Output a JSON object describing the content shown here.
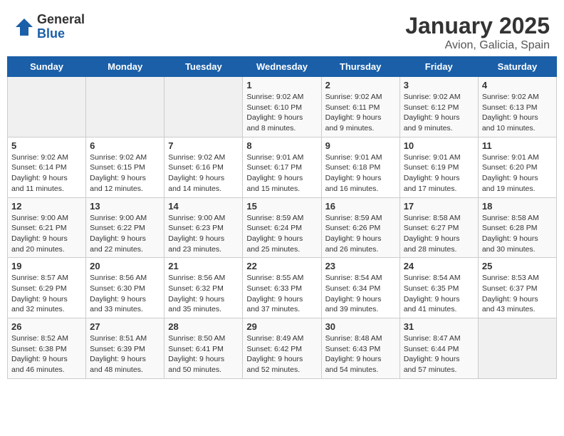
{
  "header": {
    "logo_general": "General",
    "logo_blue": "Blue",
    "title": "January 2025",
    "subtitle": "Avion, Galicia, Spain"
  },
  "weekdays": [
    "Sunday",
    "Monday",
    "Tuesday",
    "Wednesday",
    "Thursday",
    "Friday",
    "Saturday"
  ],
  "weeks": [
    [
      {
        "day": "",
        "info": ""
      },
      {
        "day": "",
        "info": ""
      },
      {
        "day": "",
        "info": ""
      },
      {
        "day": "1",
        "info": "Sunrise: 9:02 AM\nSunset: 6:10 PM\nDaylight: 9 hours and 8 minutes."
      },
      {
        "day": "2",
        "info": "Sunrise: 9:02 AM\nSunset: 6:11 PM\nDaylight: 9 hours and 9 minutes."
      },
      {
        "day": "3",
        "info": "Sunrise: 9:02 AM\nSunset: 6:12 PM\nDaylight: 9 hours and 9 minutes."
      },
      {
        "day": "4",
        "info": "Sunrise: 9:02 AM\nSunset: 6:13 PM\nDaylight: 9 hours and 10 minutes."
      }
    ],
    [
      {
        "day": "5",
        "info": "Sunrise: 9:02 AM\nSunset: 6:14 PM\nDaylight: 9 hours and 11 minutes."
      },
      {
        "day": "6",
        "info": "Sunrise: 9:02 AM\nSunset: 6:15 PM\nDaylight: 9 hours and 12 minutes."
      },
      {
        "day": "7",
        "info": "Sunrise: 9:02 AM\nSunset: 6:16 PM\nDaylight: 9 hours and 14 minutes."
      },
      {
        "day": "8",
        "info": "Sunrise: 9:01 AM\nSunset: 6:17 PM\nDaylight: 9 hours and 15 minutes."
      },
      {
        "day": "9",
        "info": "Sunrise: 9:01 AM\nSunset: 6:18 PM\nDaylight: 9 hours and 16 minutes."
      },
      {
        "day": "10",
        "info": "Sunrise: 9:01 AM\nSunset: 6:19 PM\nDaylight: 9 hours and 17 minutes."
      },
      {
        "day": "11",
        "info": "Sunrise: 9:01 AM\nSunset: 6:20 PM\nDaylight: 9 hours and 19 minutes."
      }
    ],
    [
      {
        "day": "12",
        "info": "Sunrise: 9:00 AM\nSunset: 6:21 PM\nDaylight: 9 hours and 20 minutes."
      },
      {
        "day": "13",
        "info": "Sunrise: 9:00 AM\nSunset: 6:22 PM\nDaylight: 9 hours and 22 minutes."
      },
      {
        "day": "14",
        "info": "Sunrise: 9:00 AM\nSunset: 6:23 PM\nDaylight: 9 hours and 23 minutes."
      },
      {
        "day": "15",
        "info": "Sunrise: 8:59 AM\nSunset: 6:24 PM\nDaylight: 9 hours and 25 minutes."
      },
      {
        "day": "16",
        "info": "Sunrise: 8:59 AM\nSunset: 6:26 PM\nDaylight: 9 hours and 26 minutes."
      },
      {
        "day": "17",
        "info": "Sunrise: 8:58 AM\nSunset: 6:27 PM\nDaylight: 9 hours and 28 minutes."
      },
      {
        "day": "18",
        "info": "Sunrise: 8:58 AM\nSunset: 6:28 PM\nDaylight: 9 hours and 30 minutes."
      }
    ],
    [
      {
        "day": "19",
        "info": "Sunrise: 8:57 AM\nSunset: 6:29 PM\nDaylight: 9 hours and 32 minutes."
      },
      {
        "day": "20",
        "info": "Sunrise: 8:56 AM\nSunset: 6:30 PM\nDaylight: 9 hours and 33 minutes."
      },
      {
        "day": "21",
        "info": "Sunrise: 8:56 AM\nSunset: 6:32 PM\nDaylight: 9 hours and 35 minutes."
      },
      {
        "day": "22",
        "info": "Sunrise: 8:55 AM\nSunset: 6:33 PM\nDaylight: 9 hours and 37 minutes."
      },
      {
        "day": "23",
        "info": "Sunrise: 8:54 AM\nSunset: 6:34 PM\nDaylight: 9 hours and 39 minutes."
      },
      {
        "day": "24",
        "info": "Sunrise: 8:54 AM\nSunset: 6:35 PM\nDaylight: 9 hours and 41 minutes."
      },
      {
        "day": "25",
        "info": "Sunrise: 8:53 AM\nSunset: 6:37 PM\nDaylight: 9 hours and 43 minutes."
      }
    ],
    [
      {
        "day": "26",
        "info": "Sunrise: 8:52 AM\nSunset: 6:38 PM\nDaylight: 9 hours and 46 minutes."
      },
      {
        "day": "27",
        "info": "Sunrise: 8:51 AM\nSunset: 6:39 PM\nDaylight: 9 hours and 48 minutes."
      },
      {
        "day": "28",
        "info": "Sunrise: 8:50 AM\nSunset: 6:41 PM\nDaylight: 9 hours and 50 minutes."
      },
      {
        "day": "29",
        "info": "Sunrise: 8:49 AM\nSunset: 6:42 PM\nDaylight: 9 hours and 52 minutes."
      },
      {
        "day": "30",
        "info": "Sunrise: 8:48 AM\nSunset: 6:43 PM\nDaylight: 9 hours and 54 minutes."
      },
      {
        "day": "31",
        "info": "Sunrise: 8:47 AM\nSunset: 6:44 PM\nDaylight: 9 hours and 57 minutes."
      },
      {
        "day": "",
        "info": ""
      }
    ]
  ]
}
